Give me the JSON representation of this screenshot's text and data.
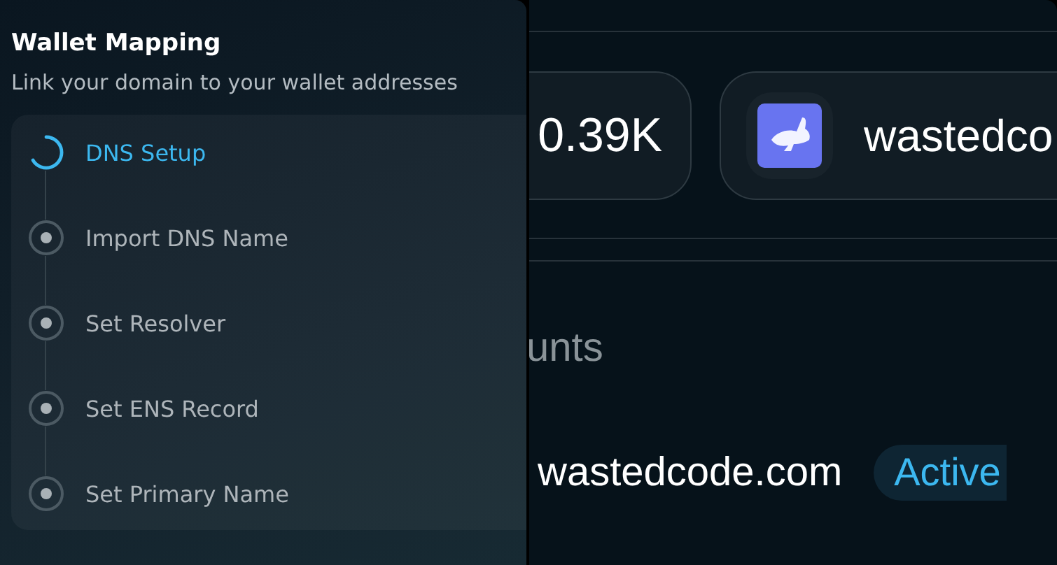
{
  "wallet_mapping": {
    "title": "Wallet Mapping",
    "subtitle": "Link your domain to your wallet addresses",
    "steps": [
      {
        "label": "DNS Setup",
        "active": true
      },
      {
        "label": "Import DNS Name",
        "active": false
      },
      {
        "label": "Set Resolver",
        "active": false
      },
      {
        "label": "Set ENS Record",
        "active": false
      },
      {
        "label": "Set Primary Name",
        "active": false
      }
    ]
  },
  "background_page": {
    "stat_value": "0.39K",
    "account_name": "wastedco",
    "section_heading": "unts",
    "domains": [
      {
        "name": "wastedcode.com",
        "status": "Active"
      }
    ]
  }
}
